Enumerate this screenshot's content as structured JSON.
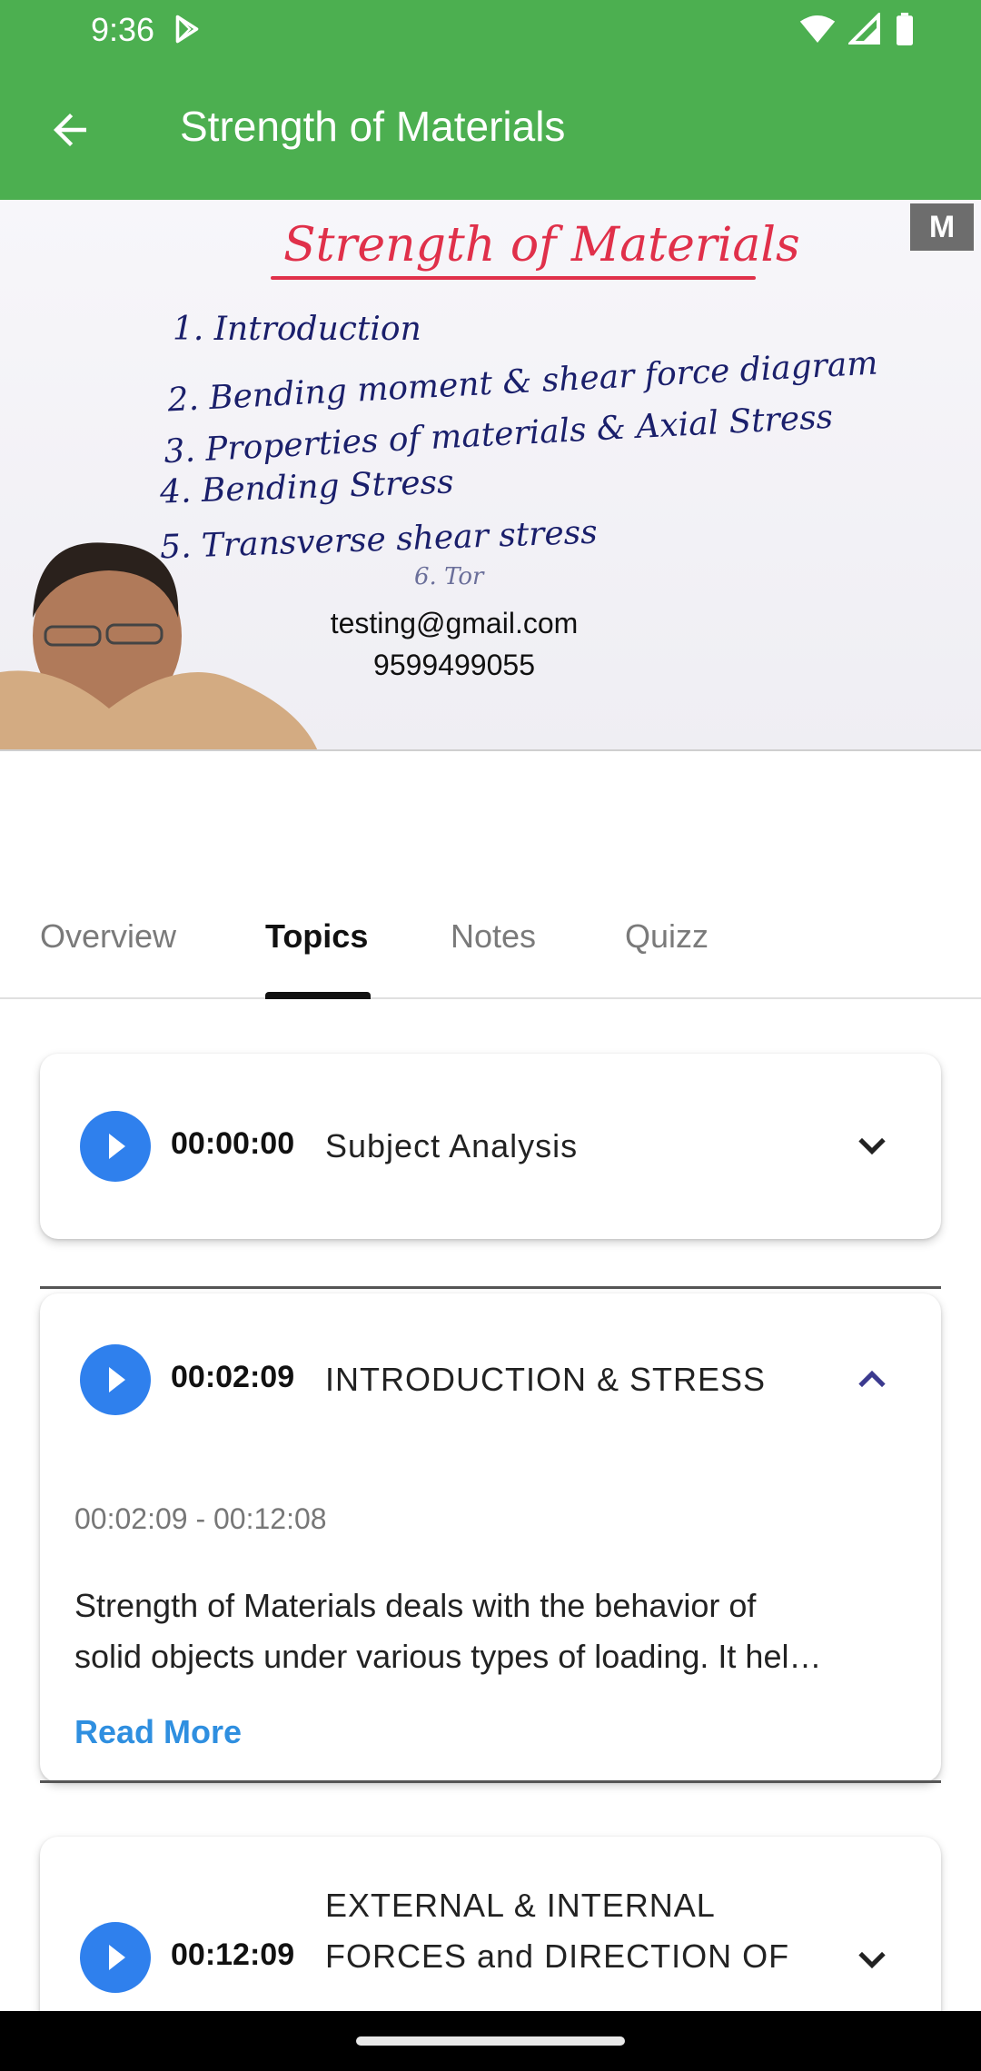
{
  "status_bar": {
    "time": "9:36",
    "icons": [
      "play-store-icon",
      "wifi-icon",
      "signal-icon",
      "battery-icon"
    ]
  },
  "app_bar": {
    "title": "Strength of Materials",
    "back_icon": "arrow-back-icon",
    "color": "#4CAF50"
  },
  "video": {
    "board_title": "Strength of Materials",
    "board_lines": [
      "1. Introduction",
      "2. Bending moment & shear force diagram",
      "3. Properties of materials & Axial Stress",
      "4. Bending Stress",
      "5. Transverse shear stress",
      "6. Tor"
    ],
    "logo_text": "M",
    "watermark_email": "testing@gmail.com",
    "watermark_phone": "9599499055"
  },
  "tabs": {
    "items": [
      "Overview",
      "Topics",
      "Notes",
      "Quizz"
    ],
    "active": "Topics"
  },
  "topics": [
    {
      "time": "00:00:00",
      "title": "Subject Analysis",
      "expanded": false
    },
    {
      "time": "00:02:09",
      "title": "INTRODUCTION & STRESS",
      "expanded": true,
      "range": "00:02:09 - 00:12:08",
      "description_line1": "Strength of Materials deals with the behavior of",
      "description_line2": "solid objects under various types of loading. It hel…",
      "read_more": "Read More"
    },
    {
      "time": "00:12:09",
      "title_line1": "EXTERNAL & INTERNAL",
      "title_line2": "FORCES and DIRECTION OF",
      "expanded": false
    }
  ],
  "colors": {
    "accent_blue": "#2f80ed",
    "link_blue": "#2f8fe0",
    "chevron_up": "#3b3a8f"
  }
}
